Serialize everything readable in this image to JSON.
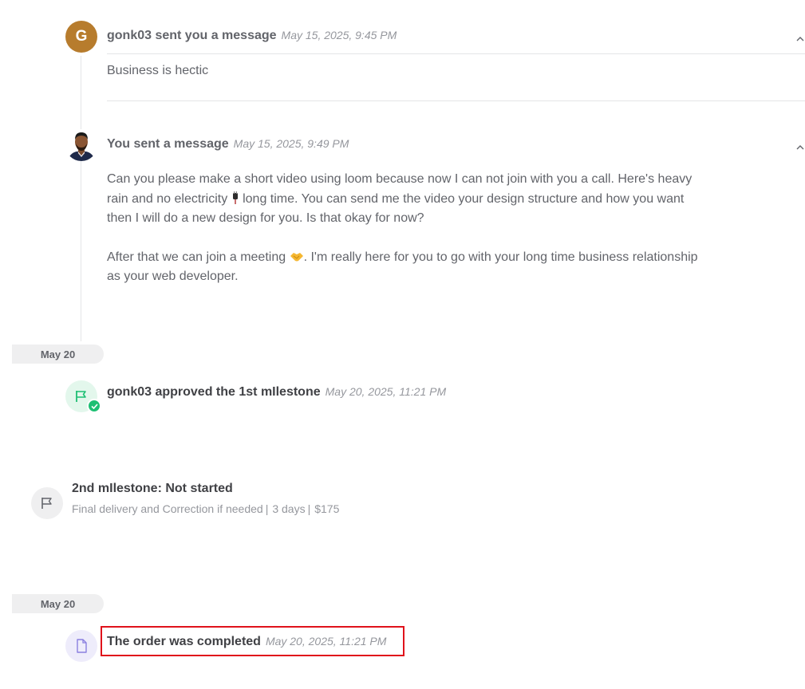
{
  "messages": [
    {
      "avatar_letter": "G",
      "sender_text": "gonk03 sent you a message",
      "time": "May 15, 2025, 9:45 PM",
      "body": "Business is hectic"
    },
    {
      "sender_text": "You sent a message",
      "time": "May 15, 2025, 9:49 PM",
      "body_line1_a": "Can you please make a short video using loom because now I can not join with you a call. Here's heavy rain and no electricity",
      "body_line1_b": "long time. You can send me the video your design structure and how you want then I will do a new design for you. Is that okay for now?",
      "body_line2_a": "After that we can join a meeting",
      "body_line2_b": ". I'm really here for you to go with your long time business relationship as your web developer."
    }
  ],
  "date_separators": [
    "May 20",
    "May 20"
  ],
  "milestone_approved": {
    "text": "gonk03 approved the 1st mIlestone",
    "time": "May 20, 2025, 11:21 PM"
  },
  "milestone_2": {
    "title": "2nd mIlestone: Not started",
    "description": "Final delivery and Correction if needed",
    "duration": "3 days",
    "price": "$175"
  },
  "order_completed": {
    "text": "The order was completed",
    "time": "May 20, 2025, 11:21 PM"
  },
  "colors": {
    "avatar_bg": "#b77c2d",
    "approved_icon_bg": "#e3f7ec",
    "approved_accent": "#1dbf73",
    "order_icon_bg": "#eeecfb",
    "order_accent": "#8a7fe0",
    "highlight": "#e0121b"
  },
  "icons": {
    "collapse": "chevron-up-icon",
    "approved": "flag-icon",
    "approved_badge": "check-icon",
    "milestone": "flag-icon",
    "order": "document-icon",
    "emoji_plug": "electric-plug-icon",
    "emoji_handshake": "handshake-icon"
  }
}
